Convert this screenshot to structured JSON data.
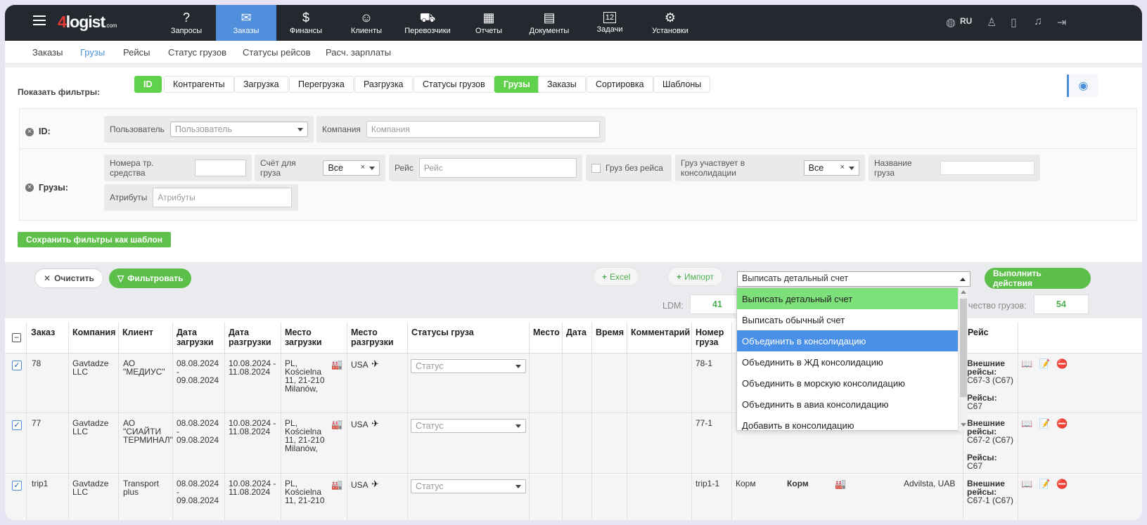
{
  "app": {
    "logo_four": "4",
    "logo_text": "logist",
    "logo_com": ".com"
  },
  "nav": [
    {
      "label": "Запросы",
      "icon": "?"
    },
    {
      "label": "Заказы",
      "icon": "✉",
      "active": true
    },
    {
      "label": "Финансы",
      "icon": "$"
    },
    {
      "label": "Клиенты",
      "icon": "☺"
    },
    {
      "label": "Перевозчики",
      "icon": "⛟"
    },
    {
      "label": "Отчеты",
      "icon": "▦"
    },
    {
      "label": "Документы",
      "icon": "▤"
    },
    {
      "label": "Задачи",
      "icon": "12"
    },
    {
      "label": "Установки",
      "icon": "⚙"
    }
  ],
  "lang": "RU",
  "subnav": [
    "Заказы",
    "Грузы",
    "Рейсы",
    "Статус грузов",
    "Статусы рейсов",
    "Расч. зарплаты"
  ],
  "filters": {
    "show_label": "Показать фильтры:",
    "chips": [
      "ID",
      "Контрагенты",
      "Загрузка",
      "Перегрузка",
      "Разгрузка",
      "Статусы грузов",
      "Грузы",
      "Заказы",
      "Сортировка",
      "Шаблоны"
    ],
    "id_label": "ID:",
    "user_label": "Пользователь",
    "user_placeholder": "Пользователь",
    "company_label": "Компания",
    "company_placeholder": "Компания",
    "cargo_label": "Грузы:",
    "vehicle_label": "Номера тр. средства",
    "invoice_label": "Счёт для груза",
    "invoice_value": "Все",
    "trip_label": "Рейс",
    "trip_placeholder": "Рейс",
    "notrip_label": "Груз без рейса",
    "consol_label": "Груз участвует в консолидации",
    "consol_value": "Все",
    "name_label": "Название груза",
    "attr_label": "Атрибуты",
    "attr_placeholder": "Атрибуты",
    "save_template": "Сохранить фильтры как шаблон"
  },
  "actions": {
    "clear": "Очистить",
    "filter": "Фильтровать",
    "excel": "Excel",
    "import": "Импорт",
    "selected_action": "Выписать детальный счет",
    "execute": "Выполнить действия",
    "ldm_label": "LDM:",
    "ldm_value": "41",
    "count_label": "чество грузов:",
    "count_value": "54",
    "options": [
      "Выписать детальный счет",
      "Выписать обычный счет",
      "Объединить в консолидацию",
      "Объединить в ЖД консолидацию",
      "Объединить в морскую консолидацию",
      "Объединить в авиа консолидацию",
      "Добавить в консолидацию"
    ]
  },
  "table": {
    "headers": [
      "Заказ",
      "Компания",
      "Клиент",
      "Дата загрузки",
      "Дата разгрузки",
      "Место загрузки",
      "Место разгрузки",
      "Статусы груза",
      "Место",
      "Дата",
      "Время",
      "Комментарий",
      "Номер груза",
      "Рейс"
    ],
    "status_placeholder": "Статус",
    "rows": [
      {
        "order": "78",
        "company": "Gavtadze LLC",
        "client": "АО \"МЕДИУС\"",
        "load_date": "08.08.2024 - 09.08.2024",
        "unload_date": "10.08.2024 - 11.08.2024",
        "load_place": "PL, Kościelna 11, 21-210 Milanów,",
        "unload_place": "USA",
        "cargo_no": "78-1",
        "trip_ext_label": "Внешние рейсы:",
        "trip_ext": "C67-3 (C67)",
        "trip_label": "Рейсы:",
        "trip": "C67"
      },
      {
        "order": "77",
        "company": "Gavtadze LLC",
        "client": "АО \"СИАЙТИ ТЕРМИНАЛ\"",
        "load_date": "08.08.2024 - 09.08.2024",
        "unload_date": "10.08.2024 - 11.08.2024",
        "load_place": "PL, Kościelna 11, 21-210 Milanów,",
        "unload_place": "USA",
        "cargo_no": "77-1",
        "trip_ext_label": "Внешние рейсы:",
        "trip_ext": "C67-2 (C67)",
        "trip_label": "Рейсы:",
        "trip": "C67"
      },
      {
        "order": "trip1",
        "company": "Gavtadze LLC",
        "client": "Transport plus",
        "load_date": "08.08.2024 - 09.08.2024",
        "unload_date": "10.08.2024 - 11.08.2024",
        "load_place": "PL, Kościelna 11, 21-210",
        "unload_place": "USA",
        "cargo_no": "trip1-1",
        "extra1": "Корм",
        "extra2": "Корм",
        "carrier": "Advilsta, UAB",
        "trip_ext_label": "Внешние рейсы:",
        "trip_ext": "C67-1 (C67)"
      }
    ]
  }
}
